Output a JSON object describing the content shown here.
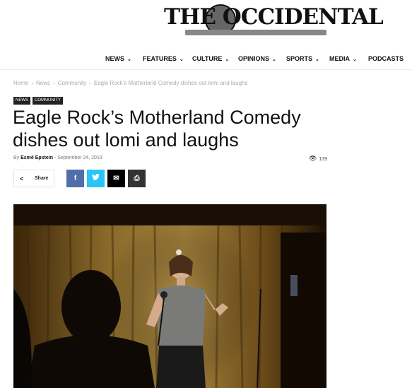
{
  "logo": {
    "text": "THE OCCIDENTAL"
  },
  "nav": {
    "items": [
      {
        "label": "NEWS",
        "has_dropdown": true
      },
      {
        "label": "FEATURES",
        "has_dropdown": true
      },
      {
        "label": "CULTURE",
        "has_dropdown": true
      },
      {
        "label": "OPINIONS",
        "has_dropdown": true
      },
      {
        "label": "SPORTS",
        "has_dropdown": true
      },
      {
        "label": "MEDIA",
        "has_dropdown": true
      },
      {
        "label": "PODCASTS",
        "has_dropdown": false
      }
    ],
    "chevron": "⌄"
  },
  "breadcrumb": {
    "items": [
      "Home",
      "News",
      "Community",
      "Eagle Rock's Motherland Comedy dishes out lomi and laughs"
    ],
    "separator": "›"
  },
  "tags": [
    "NEWS",
    "COMMUNITY"
  ],
  "article": {
    "title": "Eagle Rock’s Motherland Comedy dishes out lomi and laughs",
    "by_prefix": "By",
    "author": "Esmé Epstein",
    "dash": "-",
    "date": "September 24, 2019",
    "views": "139"
  },
  "share": {
    "label": "Share",
    "buttons": [
      {
        "name": "facebook",
        "glyph": "f",
        "color": "#516eab"
      },
      {
        "name": "twitter",
        "glyph": "t",
        "color": "#29c5f6"
      },
      {
        "name": "email",
        "glyph": "✉",
        "color": "#000000"
      },
      {
        "name": "print",
        "glyph": "⎙",
        "color": "#333333"
      }
    ]
  },
  "colors": {
    "accent": "#222222",
    "curtain": "#8a6a2a"
  }
}
